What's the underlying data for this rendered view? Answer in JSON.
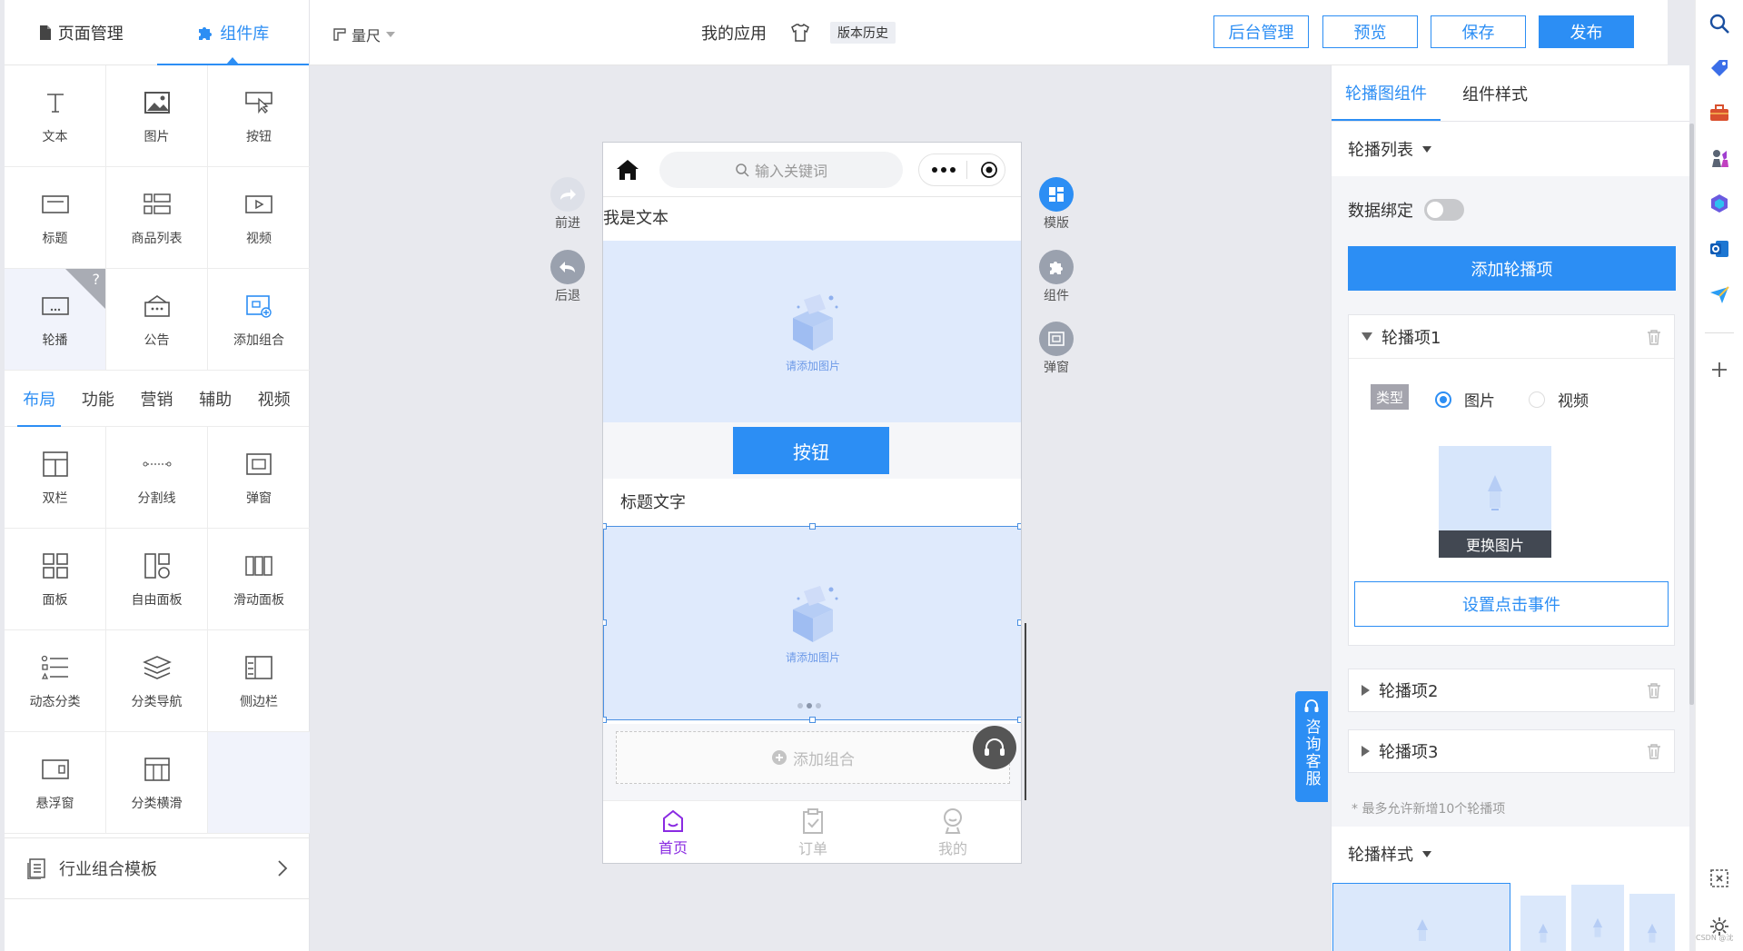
{
  "left_tabs": [
    {
      "label": "页面管理"
    },
    {
      "label": "组件库"
    }
  ],
  "basic_components": [
    {
      "label": "文本",
      "icon": "text-icon"
    },
    {
      "label": "图片",
      "icon": "image-icon"
    },
    {
      "label": "按钮",
      "icon": "button-icon"
    },
    {
      "label": "标题",
      "icon": "title-icon"
    },
    {
      "label": "商品列表",
      "icon": "product-list-icon"
    },
    {
      "label": "视频",
      "icon": "video-icon"
    },
    {
      "label": "轮播",
      "icon": "carousel-icon"
    },
    {
      "label": "公告",
      "icon": "notice-icon"
    },
    {
      "label": "添加组合",
      "icon": "add-group-icon"
    }
  ],
  "help_badge": "?",
  "sub_tabs": [
    {
      "label": "布局"
    },
    {
      "label": "功能"
    },
    {
      "label": "营销"
    },
    {
      "label": "辅助"
    },
    {
      "label": "视频"
    }
  ],
  "layout_components": [
    {
      "label": "双栏",
      "icon": "two-column-icon"
    },
    {
      "label": "分割线",
      "icon": "divider-icon"
    },
    {
      "label": "弹窗",
      "icon": "popup-icon"
    },
    {
      "label": "面板",
      "icon": "panel-icon"
    },
    {
      "label": "自由面板",
      "icon": "free-panel-icon"
    },
    {
      "label": "滑动面板",
      "icon": "slide-panel-icon"
    },
    {
      "label": "动态分类",
      "icon": "dynamic-category-icon"
    },
    {
      "label": "分类导航",
      "icon": "category-nav-icon"
    },
    {
      "label": "侧边栏",
      "icon": "sidebar-icon"
    },
    {
      "label": "悬浮窗",
      "icon": "floating-window-icon"
    },
    {
      "label": "分类横滑",
      "icon": "category-scroll-icon"
    }
  ],
  "industry_template": "行业组合模板",
  "topbar": {
    "ruler": "量尺",
    "app_name": "我的应用",
    "version_history": "版本历史",
    "buttons": {
      "admin": "后台管理",
      "preview": "预览",
      "save": "保存",
      "publish": "发布"
    }
  },
  "canvas": {
    "forward": "前进",
    "back": "后退",
    "template": "模版",
    "component": "组件",
    "popup": "弹窗"
  },
  "phone": {
    "search_placeholder": "输入关键词",
    "text_block": "我是文本",
    "image_placeholder": "请添加图片",
    "button_label": "按钮",
    "title_text": "标题文字",
    "carousel_placeholder": "请添加图片",
    "add_group": "添加组合",
    "tabbar": [
      {
        "label": "首页"
      },
      {
        "label": "订单"
      },
      {
        "label": "我的"
      }
    ]
  },
  "service_tab": "咨询客服",
  "right": {
    "tabs": [
      {
        "label": "轮播图组件"
      },
      {
        "label": "组件样式"
      }
    ],
    "carousel_list": "轮播列表",
    "data_binding": "数据绑定",
    "add_item": "添加轮播项",
    "items": [
      {
        "title": "轮播项1"
      },
      {
        "title": "轮播项2"
      },
      {
        "title": "轮播项3"
      }
    ],
    "type_label": "类型",
    "type_options": [
      "图片",
      "视频"
    ],
    "change_image": "更换图片",
    "set_click": "设置点击事件",
    "max_note": "* 最多允许新增10个轮播项",
    "carousel_style": "轮播样式"
  },
  "watermark": "CSDN @沈"
}
